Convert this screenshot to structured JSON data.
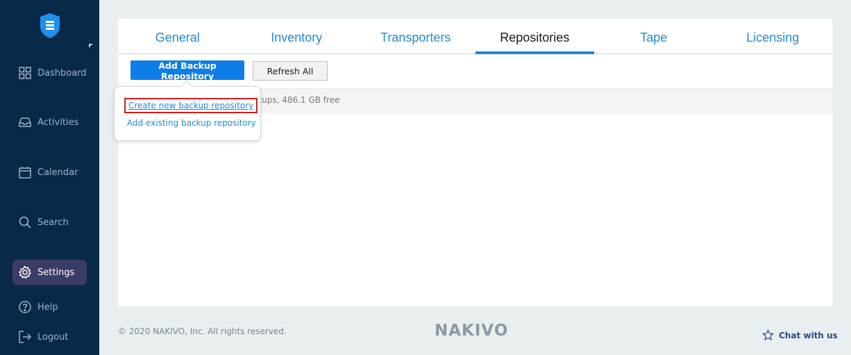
{
  "sidebar": {
    "items": [
      {
        "label": "Dashboard",
        "icon": "grid-icon"
      },
      {
        "label": "Activities",
        "icon": "inbox-icon"
      },
      {
        "label": "Calendar",
        "icon": "calendar-icon"
      },
      {
        "label": "Search",
        "icon": "search-icon"
      },
      {
        "label": "Settings",
        "icon": "gear-icon"
      },
      {
        "label": "Help",
        "icon": "help-icon"
      },
      {
        "label": "Logout",
        "icon": "logout-icon"
      }
    ],
    "active": "Settings"
  },
  "tabs": [
    {
      "label": "General"
    },
    {
      "label": "Inventory"
    },
    {
      "label": "Transporters"
    },
    {
      "label": "Repositories"
    },
    {
      "label": "Tape"
    },
    {
      "label": "Licensing"
    }
  ],
  "active_tab": "Repositories",
  "toolbar": {
    "add_label": "Add Backup Repository",
    "refresh_label": "Refresh All"
  },
  "repository_row": {
    "info": "ckups, 486.1 GB free"
  },
  "dropdown": {
    "create_label": "Create new backup repository",
    "add_existing_label": "Add existing backup repository"
  },
  "footer": {
    "copyright": "© 2020 NAKIVO, Inc. All rights reserved.",
    "brand": "NAKIVO",
    "chat_label": "Chat with us"
  },
  "colors": {
    "sidebar_bg": "#082948",
    "accent": "#1e8ad6",
    "primary_button": "#0d7ee8",
    "highlight_box": "#d01c1c"
  }
}
